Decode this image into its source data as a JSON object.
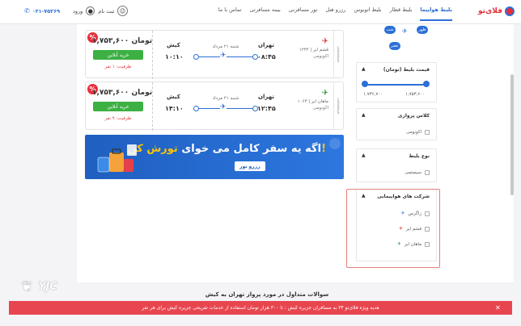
{
  "header": {
    "logo_text": "فلای‌تو",
    "nav": [
      "بلیط هواپیما",
      "بلیط قطار",
      "بلیط اتوبوس",
      "رزرو هتل",
      "تور مسافرتی",
      "بیمه مسافرتی",
      "تماس با ما"
    ],
    "active_index": 0,
    "login_label": "ورود",
    "signup_label": "ثبت نام",
    "phone": "۰۲۱-۷۵۲۶۹"
  },
  "flights": [
    {
      "airline": "قشم ایر | ۱۲۴۴",
      "class": "اکونومی",
      "type": "سیستمی",
      "origin": "تهران",
      "origin_time": "۰۸:۴۵",
      "destination": "کیش",
      "destination_time": "۱۰:۱۰",
      "date": "شنبه ۲۱ مرداد",
      "price": "۱,۷۵۳,۶۰۰ تومان",
      "buy_label": "خرید آنلاین",
      "capacity": "ظرفیت: ۱ نفر"
    },
    {
      "airline": "ماهان ایر | ۱۰۶۳",
      "class": "اکونومی",
      "type": "سیستمی",
      "origin": "تهران",
      "origin_time": "۱۲:۴۵",
      "destination": "کیش",
      "destination_time": "۱۴:۱۰",
      "date": "شنبه ۲۱ مرداد",
      "price": "۱,۷۵۳,۶۰۰ تومان",
      "buy_label": "خرید آنلاین",
      "capacity": "ظرفیت: ۹ نفر"
    }
  ],
  "banner": {
    "text_pre": "اگه یه سفر کامل می خوای ",
    "text_hl": "تورش کن!",
    "button": "رزرو تور"
  },
  "filters": {
    "map_nodes": [
      "شب",
      "ظهر",
      "عصر"
    ],
    "price": {
      "title": "قیمت بلیط (تومان)",
      "min": "۱,۷۳۶,۷۰۰",
      "max": "۱,۷۵۳,۶۰۰"
    },
    "class": {
      "title": "کلاس پروازی",
      "options": [
        "اکونومی"
      ]
    },
    "ticket_type": {
      "title": "نوع بلیط",
      "options": [
        "سیستمی"
      ]
    },
    "airlines": {
      "title": "شرکت های هواپیمایی",
      "options": [
        "زاگرس",
        "قشم ایر",
        "ماهان ایر"
      ]
    }
  },
  "faq_title": "سوالات متداول در مورد پرواز تهران به کیش",
  "watermark": "YJC",
  "promo": "هدیه ویژه فلای‌تو ۳۴ به مسافران جزیره کیش : تا ۳۰۰ هزار تومان استفاده از خدمات تفریحی جزیره کیش برای هر نفر",
  "colors": {
    "brand": "#e52e3a",
    "accent": "#2d6fd6",
    "buy": "#3cb043",
    "promo": "#e8464f"
  }
}
